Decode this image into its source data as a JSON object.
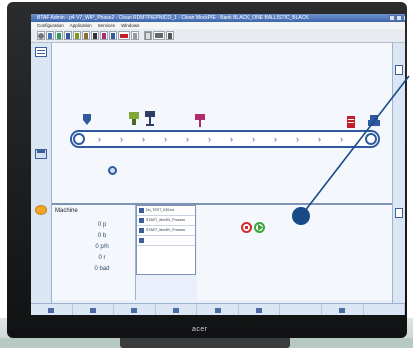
{
  "window": {
    "title": "BTAF Admin - p4 V7_WIP_Phase2 - Clean RDMTPIEPNICO_1 - Clean MockPIE - Bank BLACK_ONE BALLISTIC_BLACK"
  },
  "menu": {
    "items": [
      "Configuration",
      "Application",
      "Services",
      "Windows"
    ]
  },
  "machine": {
    "title": "Machine",
    "rows": [
      "0 p",
      "0 b",
      "0 p/h",
      "0 r",
      "0 bad"
    ]
  },
  "list": {
    "rows": [
      "Do_TEST_039.txt",
      "START_itemSV_Process",
      "START_itemSV_Process",
      ""
    ]
  },
  "brand": {
    "label": "acer"
  },
  "colors": {
    "accent": "#2e5aa0",
    "station_pink": "#b02a6c",
    "station_red": "#c41e2b",
    "start_green": "#3aa63a",
    "stop_red": "#d12b2b",
    "pointer": "#1a4a86"
  }
}
